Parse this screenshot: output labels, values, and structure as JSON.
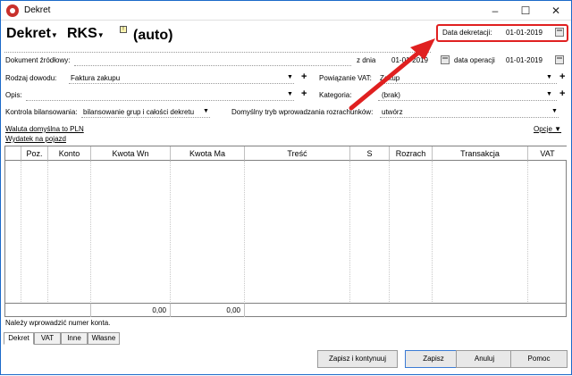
{
  "window": {
    "title": "Dekret"
  },
  "header": {
    "doc_type": "Dekret",
    "journal": "RKS",
    "auto": "(auto)",
    "booking_date_label": "Data dekretacji:",
    "booking_date": "01-01-2019"
  },
  "source_doc": {
    "label": "Dokument źródłowy:",
    "date_label": "z dnia",
    "date": "01-01-2019",
    "op_date_label": "data operacji",
    "op_date": "01-01-2019"
  },
  "proof_type": {
    "label": "Rodzaj dowodu:",
    "value": "Faktura zakupu"
  },
  "vat_link": {
    "label": "Powiązanie VAT:",
    "value": "Zakup"
  },
  "description": {
    "label": "Opis:",
    "value": ""
  },
  "category": {
    "label": "Kategoria:",
    "value": "(brak)"
  },
  "balance_control": {
    "label": "Kontrola bilansowania:",
    "value": "bilansowanie grup i całości dekretu"
  },
  "settlement_mode": {
    "label": "Domyślny tryb wprowadzania rozrachunków:",
    "value": "utwórz"
  },
  "links": {
    "currency": "Waluta domyślna to PLN",
    "expense": "Wydatek na pojazd",
    "options": "Opcje"
  },
  "grid": {
    "columns": [
      "Poz.",
      "Konto",
      "Kwota Wn",
      "Kwota Ma",
      "Treść",
      "S",
      "Rozrach",
      "Transakcja",
      "VAT"
    ],
    "rows": [],
    "total_wn": "0,00",
    "total_ma": "0,00"
  },
  "status_message": "Należy wprowadzić numer konta.",
  "tabs": [
    "Dekret",
    "VAT",
    "Inne",
    "Własne"
  ],
  "buttons": {
    "save_continue": "Zapisz i kontynuuj",
    "save": "Zapisz",
    "cancel": "Anuluj",
    "help": "Pomoc"
  },
  "colors": {
    "highlight": "#e02020",
    "arrow": "#e02020",
    "accent": "#1b6ac9"
  }
}
